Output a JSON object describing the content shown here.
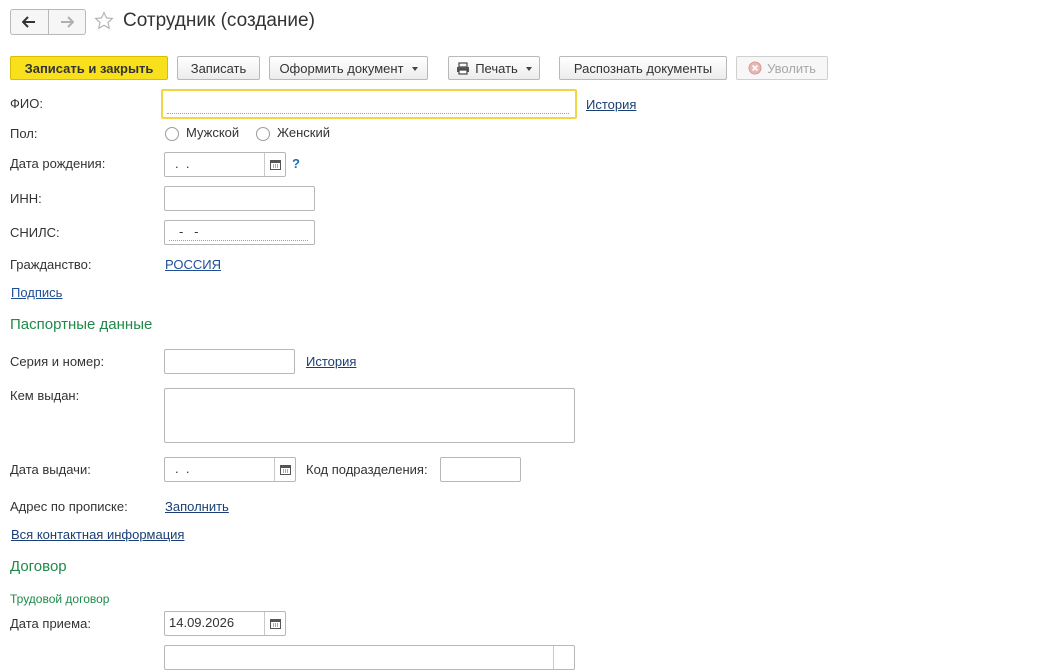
{
  "window": {
    "title": "Сотрудник (создание)"
  },
  "nav": {
    "back_icon": "arrow-left-icon",
    "forward_icon": "arrow-right-icon",
    "favorite_icon": "star-icon"
  },
  "toolbar": {
    "save_close": "Записать и закрыть",
    "save": "Записать",
    "make_doc": "Оформить документ",
    "print": "Печать",
    "recognize": "Распознать документы",
    "dismiss": "Уволить"
  },
  "form": {
    "fio_label": "ФИО:",
    "fio_value": "",
    "fio_history": "История",
    "gender_label": "Пол:",
    "gender_male": "Мужской",
    "gender_female": "Женский",
    "birth_label": "Дата рождения:",
    "birth_value": ".  .",
    "birth_help": "?",
    "inn_label": "ИНН:",
    "inn_value": "",
    "snils_label": "СНИЛС:",
    "snils_value": "-   -",
    "citizenship_label": "Гражданство:",
    "citizenship_value": "РОССИЯ",
    "signature_link": "Подпись"
  },
  "passport": {
    "heading": "Паспортные данные",
    "series_label": "Серия и номер:",
    "series_value": "",
    "series_history": "История",
    "issued_by_label": "Кем выдан:",
    "issued_by_value": "",
    "issue_date_label": "Дата выдачи:",
    "issue_date_value": ".  .",
    "division_code_label": "Код подразделения:",
    "division_code_value": "",
    "address_label": "Адрес по прописке:",
    "address_fill": "Заполнить",
    "contacts_link": "Вся контактная информация"
  },
  "contract": {
    "heading": "Договор",
    "subheading": "Трудовой договор",
    "hire_date_label": "Дата приема:",
    "hire_date_value": "14.09.2026"
  },
  "colors": {
    "primary_button": "#f8e01c",
    "section_heading": "#1f8a4a",
    "link": "#1e4e94",
    "focus_border": "#f1d545"
  }
}
